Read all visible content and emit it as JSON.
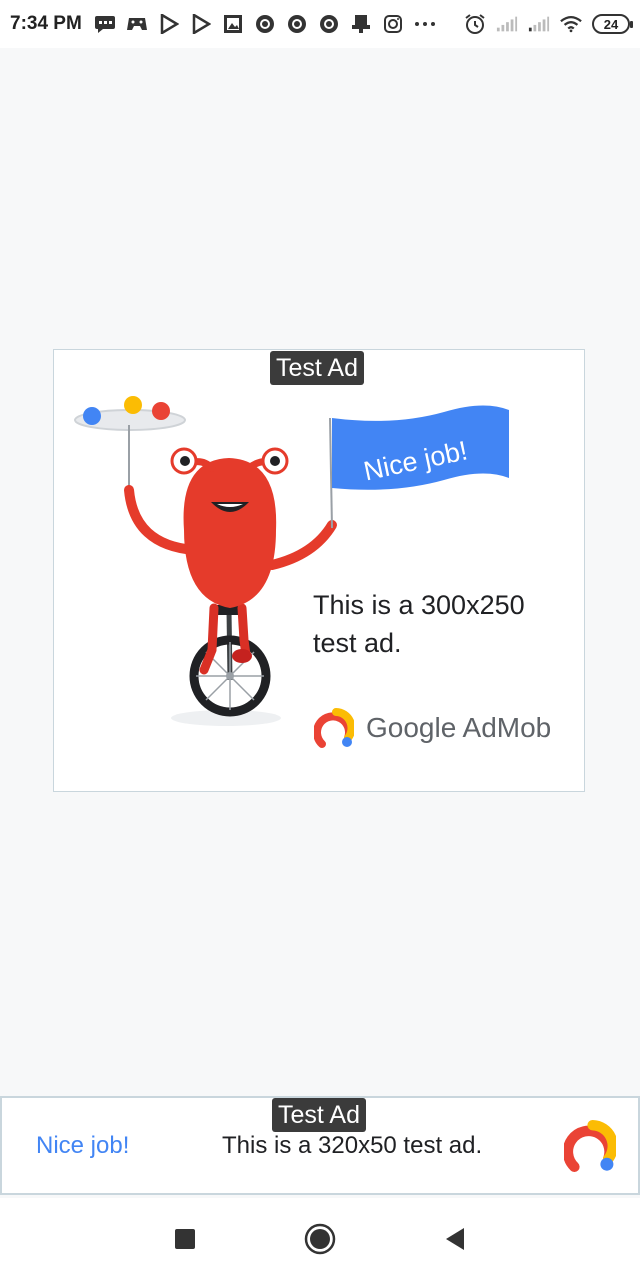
{
  "status_bar": {
    "time": "7:34 PM",
    "battery": "24",
    "icons": [
      "message-icon",
      "game-controller-icon",
      "play-store-icon",
      "play-store-icon",
      "photo-icon",
      "record-icon",
      "record-icon",
      "record-icon",
      "stamp-icon",
      "instagram-icon",
      "more-dots-icon",
      "alarm-icon",
      "signal-icon",
      "signal-icon",
      "wifi-icon",
      "battery-icon"
    ]
  },
  "ad_mrec": {
    "badge": "Test Ad",
    "flag_text": "Nice job!",
    "text": "This is a 300x250 test ad.",
    "brand": "Google AdMob"
  },
  "ad_banner": {
    "badge": "Test Ad",
    "headline": "Nice job!",
    "text": "This is a 320x50 test ad."
  },
  "colors": {
    "google_blue": "#4285f4",
    "google_red": "#ea4335",
    "google_yellow": "#fbbc04",
    "monster_red": "#e53b2b",
    "page_bg": "#f7f8f9"
  },
  "nav": {
    "icons": [
      "recents-square-icon",
      "home-circle-icon",
      "back-triangle-icon"
    ]
  }
}
